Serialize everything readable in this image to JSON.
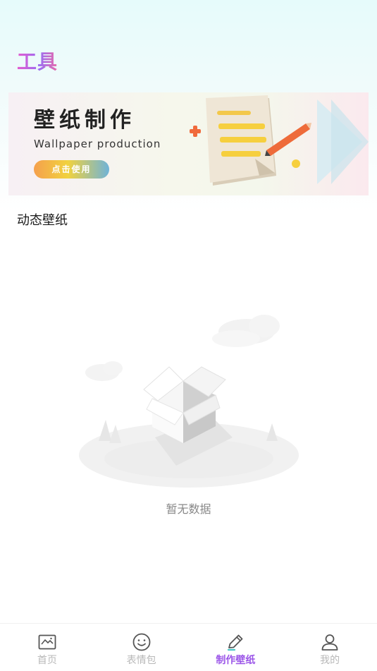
{
  "header": {
    "title": "工具"
  },
  "banner": {
    "title": "壁纸制作",
    "subtitle": "Wallpaper production",
    "button_label": "点击使用"
  },
  "section": {
    "title": "动态壁纸"
  },
  "empty_state": {
    "text": "暂无数据",
    "icon": "empty-box-illustration"
  },
  "tabbar": {
    "active_color": "#9b55e8",
    "inactive_color": "#b8b8b8",
    "items": [
      {
        "label": "首页",
        "icon": "image-icon",
        "active": false
      },
      {
        "label": "表情包",
        "icon": "smiley-icon",
        "active": false
      },
      {
        "label": "制作壁纸",
        "icon": "pencil-icon",
        "active": true
      },
      {
        "label": "我的",
        "icon": "user-icon",
        "active": false
      }
    ]
  }
}
